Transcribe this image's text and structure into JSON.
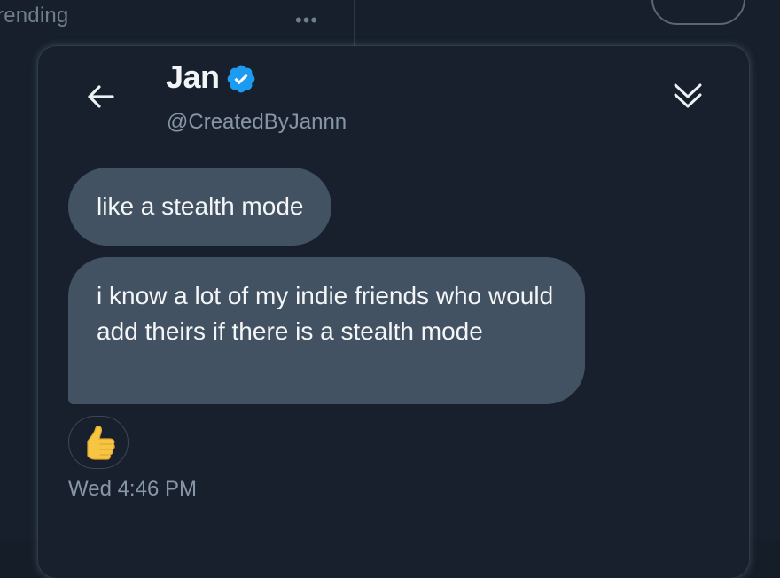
{
  "background": {
    "trending_label": "rending",
    "more_label": "•••"
  },
  "conversation": {
    "user_name": "Jan",
    "user_handle": "@CreatedByJannn",
    "verified": true,
    "messages": [
      {
        "text": "like a stealth mode"
      },
      {
        "text": "i know a lot of my indie friends who would add theirs if there is a stealth mode"
      }
    ],
    "reaction": {
      "emoji": "thumbs-up",
      "icon": "thumbs-up-icon"
    },
    "timestamp": "Wed 4:46 PM"
  },
  "colors": {
    "panel": "#17202c",
    "bubble": "#435262",
    "verified": "#1d9bf0",
    "muted_text": "#8796a6"
  },
  "icons": {
    "back": "arrow-left-icon",
    "collapse": "double-chevron-down-icon",
    "verified": "verified-badge-icon"
  }
}
